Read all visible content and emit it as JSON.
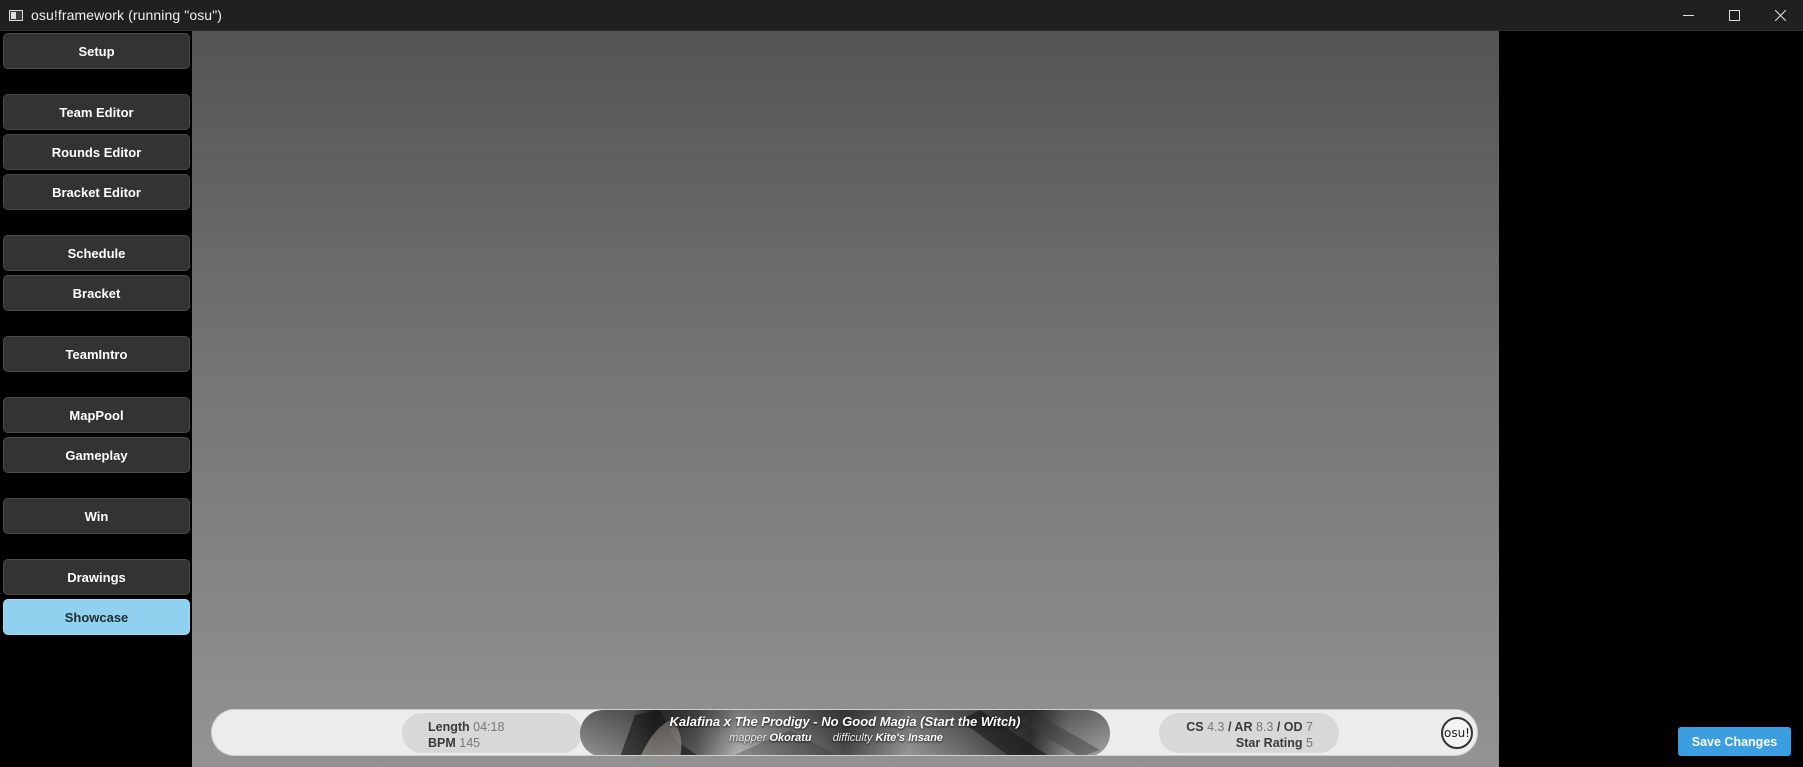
{
  "window": {
    "title": "osu!framework (running \"osu\")",
    "controls": {
      "minimize_icon": "minimize-icon",
      "maximize_icon": "maximize-icon",
      "close_icon": "close-icon"
    }
  },
  "sidebar": {
    "items": [
      {
        "label": "Setup",
        "active": false
      },
      {
        "label": "Team Editor",
        "active": false
      },
      {
        "label": "Rounds Editor",
        "active": false
      },
      {
        "label": "Bracket Editor",
        "active": false
      },
      {
        "label": "Schedule",
        "active": false
      },
      {
        "label": "Bracket",
        "active": false
      },
      {
        "label": "TeamIntro",
        "active": false
      },
      {
        "label": "MapPool",
        "active": false
      },
      {
        "label": "Gameplay",
        "active": false
      },
      {
        "label": "Win",
        "active": false
      },
      {
        "label": "Drawings",
        "active": false
      },
      {
        "label": "Showcase",
        "active": true
      }
    ],
    "active_color": "#8fd1ef",
    "button_color": "#333333"
  },
  "beatmap": {
    "length_label": "Length",
    "length_value": "04:18",
    "bpm_label": "BPM",
    "bpm_value": "145",
    "title": "Kalafina x The Prodigy - No Good Magia (Start the Witch)",
    "mapper_label": "mapper",
    "mapper_value": "Okoratu",
    "difficulty_label": "difficulty",
    "difficulty_value": "Kite's Insane",
    "cs_label": "CS",
    "cs_value": "4.3",
    "ar_label": "/ AR",
    "ar_value": "8.3",
    "od_label": "/ OD",
    "od_value": "7",
    "star_label": "Star Rating",
    "star_value": "5",
    "logo_text": "osu!"
  },
  "save_button": {
    "label": "Save Changes",
    "color": "#3a9ee0"
  }
}
